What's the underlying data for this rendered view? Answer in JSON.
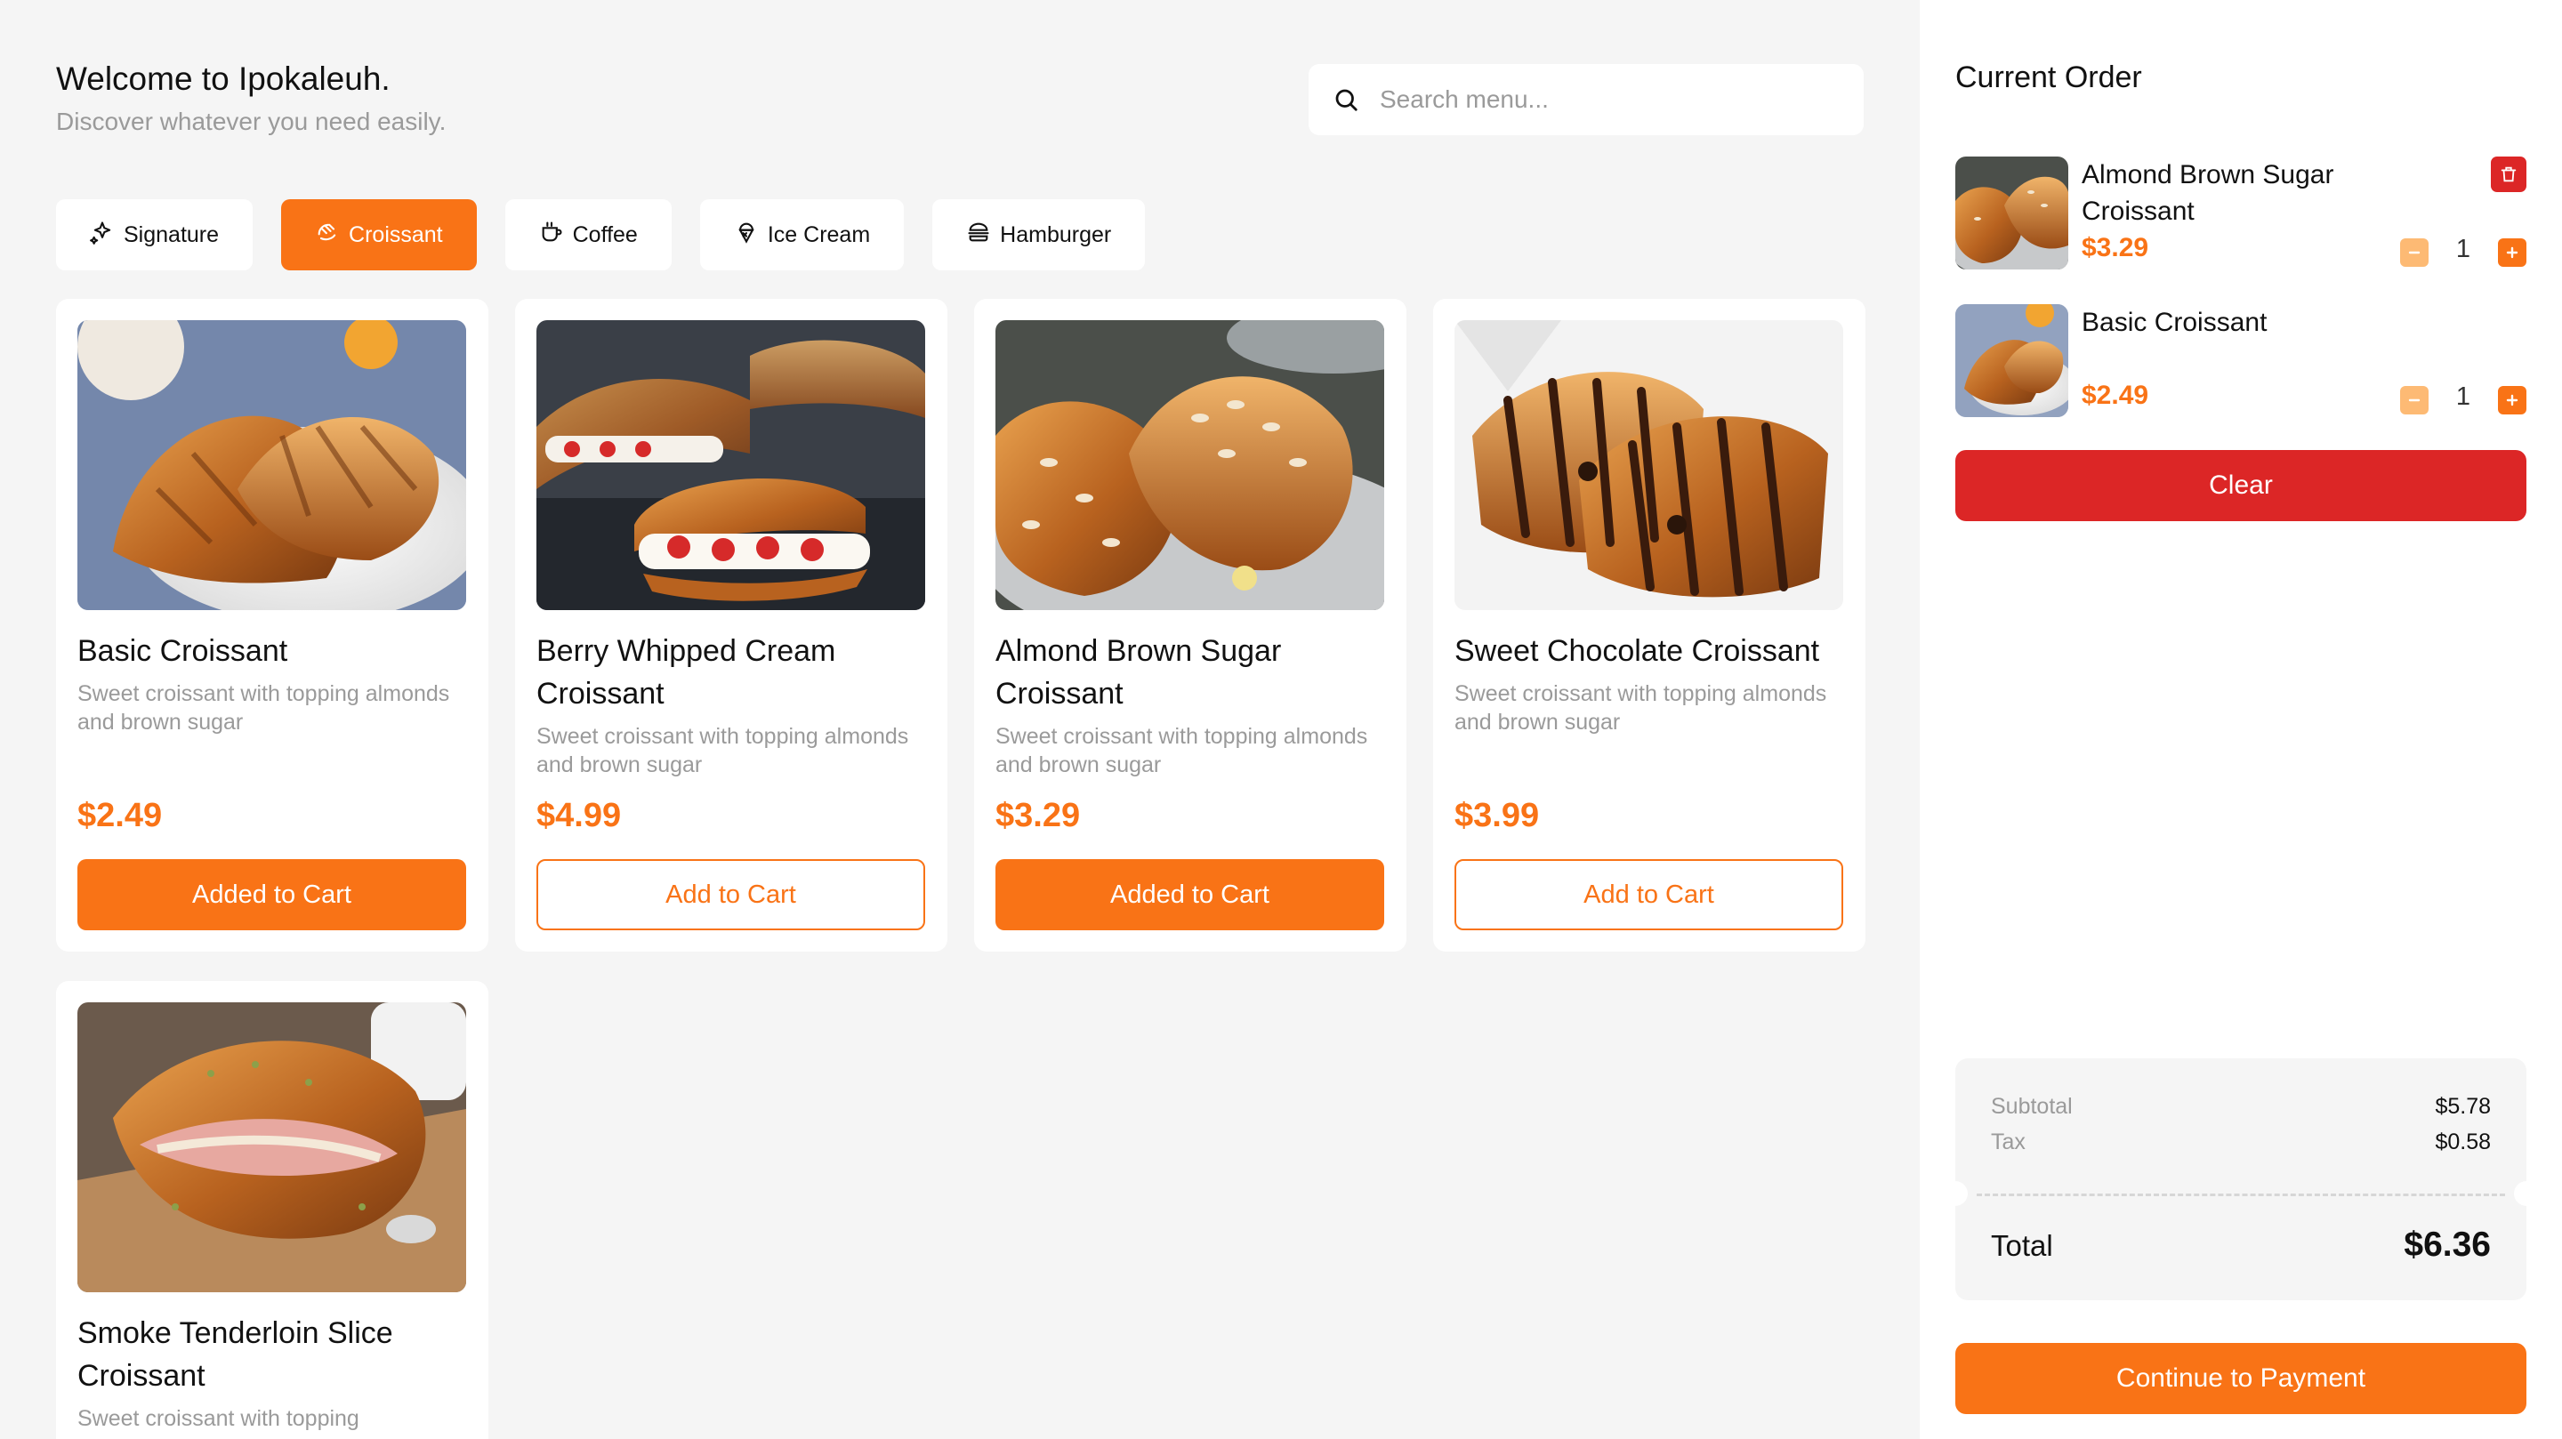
{
  "header": {
    "title": "Welcome to Ipokaleuh.",
    "subtitle": "Discover whatever you need easily."
  },
  "search": {
    "placeholder": "Search menu...",
    "value": "",
    "icon": "search-icon"
  },
  "categories": [
    {
      "label": "Signature",
      "icon": "sparkle-icon",
      "active": false
    },
    {
      "label": "Croissant",
      "icon": "croissant-icon",
      "active": true
    },
    {
      "label": "Coffee",
      "icon": "coffee-cup-icon",
      "active": false
    },
    {
      "label": "Ice Cream",
      "icon": "ice-cream-icon",
      "active": false
    },
    {
      "label": "Hamburger",
      "icon": "hamburger-icon",
      "active": false
    }
  ],
  "products": [
    {
      "name": "Basic Croissant",
      "description": "Sweet croissant with topping almonds and brown sugar",
      "price": "$2.49",
      "button": "Added to Cart",
      "in_cart": true
    },
    {
      "name": "Berry Whipped Cream Croissant",
      "description": "Sweet croissant with topping almonds and brown sugar",
      "price": "$4.99",
      "button": "Add to Cart",
      "in_cart": false
    },
    {
      "name": "Almond Brown Sugar Croissant",
      "description": "Sweet croissant with topping almonds and brown sugar",
      "price": "$3.29",
      "button": "Added to Cart",
      "in_cart": true
    },
    {
      "name": "Sweet Chocolate Croissant",
      "description": "Sweet croissant with topping almonds and brown sugar",
      "price": "$3.99",
      "button": "Add to Cart",
      "in_cart": false
    },
    {
      "name": "Smoke Tenderloin Slice Croissant",
      "description": "Sweet croissant with topping",
      "price": "",
      "button": "",
      "in_cart": false
    }
  ],
  "order": {
    "title": "Current Order",
    "items": [
      {
        "name": "Almond Brown Sugar Croissant",
        "price": "$3.29",
        "qty": "1"
      },
      {
        "name": "Basic Croissant",
        "price": "$2.49",
        "qty": "1"
      }
    ],
    "clear_label": "Clear",
    "subtotal_label": "Subtotal",
    "subtotal": "$5.78",
    "tax_label": "Tax",
    "tax": "$0.58",
    "total_label": "Total",
    "total": "$6.36",
    "pay_label": "Continue to Payment"
  },
  "colors": {
    "accent": "#f97316",
    "danger": "#dc2626",
    "background": "#f5f5f5"
  }
}
